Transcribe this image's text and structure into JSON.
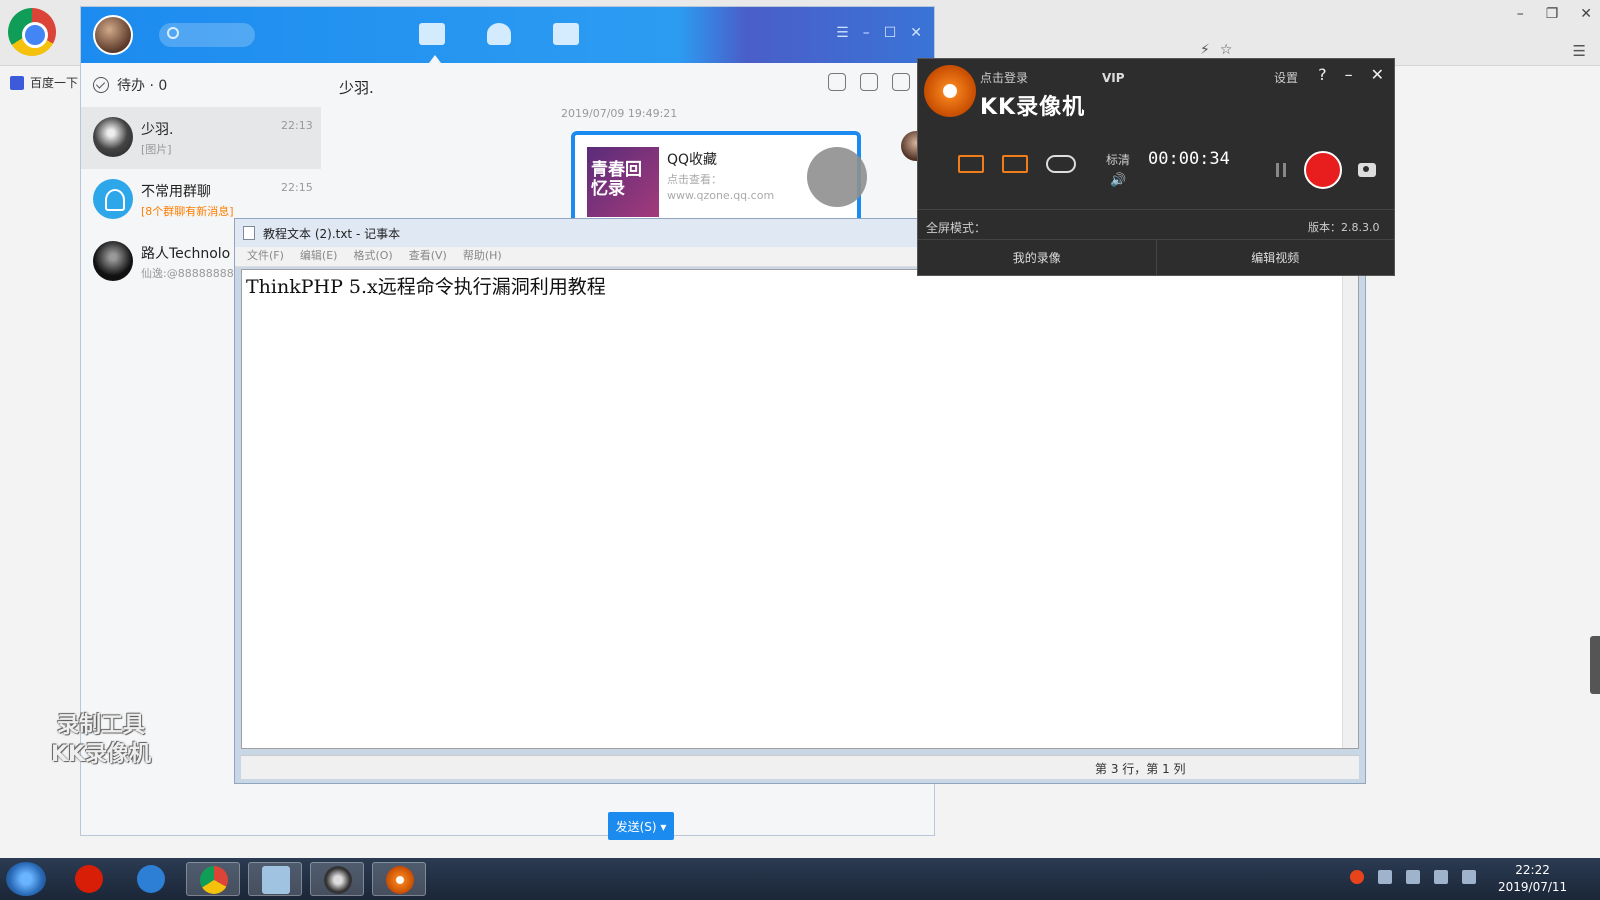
{
  "browser": {
    "bookmark_label": "百度一下",
    "window_controls": [
      "–",
      "❐",
      "✕"
    ],
    "toolbar_icons": [
      "⚡",
      "☆",
      "☰"
    ]
  },
  "qq": {
    "window_controls": [
      "☰",
      "–",
      "☐",
      "✕"
    ],
    "todo_label": "待办 · 0",
    "conversations": [
      {
        "name": "少羽.",
        "preview": "[图片]",
        "time": "22:13"
      },
      {
        "name": "不常用群聊",
        "preview": "[8个群聊有新消息]",
        "time": "22:15"
      },
      {
        "name": "路人Technolo",
        "preview": "仙逸:@88888888",
        "time": ""
      }
    ],
    "chat": {
      "title": "少羽.",
      "timestamp": "2019/07/09 19:49:21",
      "card": {
        "title": "QQ收藏",
        "thumb_text": "青春回忆录",
        "line": "点击查看：",
        "url": "www.qzone.qq.com"
      },
      "send_label": "发送(S) ▾"
    }
  },
  "notepad": {
    "title": "教程文本 (2).txt - 记事本",
    "menu": [
      "文件(F)",
      "编辑(E)",
      "格式(O)",
      "查看(V)",
      "帮助(H)"
    ],
    "content": "ThinkPHP 5.x远程命令执行漏洞利用教程",
    "status": "第 3 行，第 1 列"
  },
  "kk": {
    "login": "点击登录",
    "vip": "VIP",
    "name": "KK录像机",
    "settings": "设置",
    "controls": [
      "?",
      "–",
      "✕"
    ],
    "quality": "标清",
    "timer": "00:00:34",
    "fullscreen_label": "全屏模式：",
    "version": "版本：2.8.3.0",
    "tabs": [
      "我的录像",
      "编辑视频"
    ],
    "accent": "#f07d1a",
    "record_color": "#e81d1d"
  },
  "watermark": {
    "line1": "录制工具",
    "line2": "KK录像机"
  },
  "taskbar": {
    "time": "22:22",
    "date": "2019/07/11"
  }
}
